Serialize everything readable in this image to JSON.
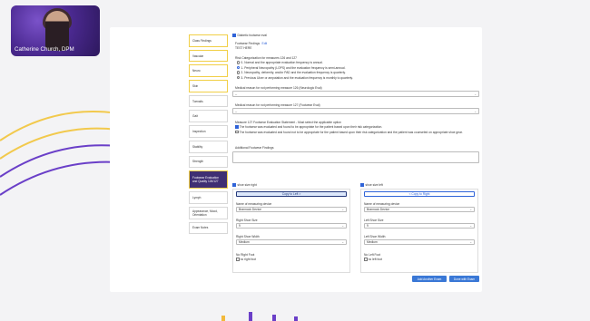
{
  "video": {
    "presenter_name": "Catherine Church, DPM"
  },
  "sidebar": {
    "items": [
      {
        "label": "Class Findings",
        "style": "hl"
      },
      {
        "label": "Vascular",
        "style": "hl"
      },
      {
        "label": "Neuro",
        "style": "hl"
      },
      {
        "label": "Skin",
        "style": "hl"
      },
      {
        "label": "Toenails",
        "style": ""
      },
      {
        "label": "Gait",
        "style": ""
      },
      {
        "label": "Inspection",
        "style": ""
      },
      {
        "label": "Stability",
        "style": ""
      },
      {
        "label": "Strength",
        "style": ""
      },
      {
        "label": "Footwear Evaluation and Quality 126/127",
        "style": "sel"
      },
      {
        "label": "Lymph",
        "style": ""
      },
      {
        "label": "Appearance, Mood, Orientation",
        "style": ""
      },
      {
        "label": "Exam Notes",
        "style": ""
      }
    ]
  },
  "main": {
    "diabetic_label": "Diabetic footwear eval",
    "findings_label": "Footwear Findings",
    "edit_label": "Edit",
    "findings_text": "TEST HERE",
    "risk_heading": "Risk Categorization for measures 126 and 127",
    "risk_options": [
      {
        "label": "0- Normal and the appropriate evaluation frequency is annual.",
        "selected": false
      },
      {
        "label": "1- Peripheral Neuropathy (LOPS) and the evaluation frequency is semi-annual.",
        "selected": true
      },
      {
        "label": "2- Neuropathy, deformity, and/or PAD and the evaluation frequency is quarterly.",
        "selected": false
      },
      {
        "label": "3- Previous Ulcer or amputation and the evaluation frequency is monthly to quarterly.",
        "selected": false
      }
    ],
    "reason126_label": "Medical reason for not performing measure 126 (Neurologic Eval)",
    "reason126_value": "--",
    "reason127_label": "Medical reason for not performing measure 127 (Footwear Eval)",
    "reason127_value": "--",
    "measure127_label": "Measure 127 Footwear Evaluation Statement - Must select the applicable option",
    "measure127_options": [
      {
        "label": "The footwear was evaluated and found to be appropriate for the patient based upon their risk categorization.",
        "checked": true
      },
      {
        "label": "The footwear was evaluated and found not to be appropriate for the patient based upon their risk categorization and the patient was counseled on appropriate shoe gear.",
        "checked": false
      }
    ],
    "additional_label": "Additional Footwear Findings"
  },
  "right_shoe": {
    "checkbox_label": "shoe size right",
    "copy_button": "Copy to Left >",
    "device_label": "Name of measuring device",
    "device_value": "Brannock Device",
    "size_label": "Right Shoe Size",
    "size_value": "9",
    "width_label": "Right Shoe Width",
    "width_value": "Medium",
    "nofoot_label": "No Right Foot",
    "nofoot_checkbox": "no right foot"
  },
  "left_shoe": {
    "checkbox_label": "shoe size left",
    "copy_button": "< Copy to Right",
    "device_label": "Name of measuring device",
    "device_value": "Brannock Device",
    "size_label": "Left Shoe Size",
    "size_value": "9",
    "width_label": "Left Shoe Width",
    "width_value": "Medium",
    "nofoot_label": "No Left Foot",
    "nofoot_checkbox": "no left foot"
  },
  "buttons": {
    "add_exam": "Add Another Exam",
    "done": "Done with Exam"
  },
  "colors": {
    "accent": "#2f63d8",
    "sidebar_selected": "#3f2f73",
    "highlight": "#f1cf46",
    "video_bg": "#4c2a92"
  }
}
